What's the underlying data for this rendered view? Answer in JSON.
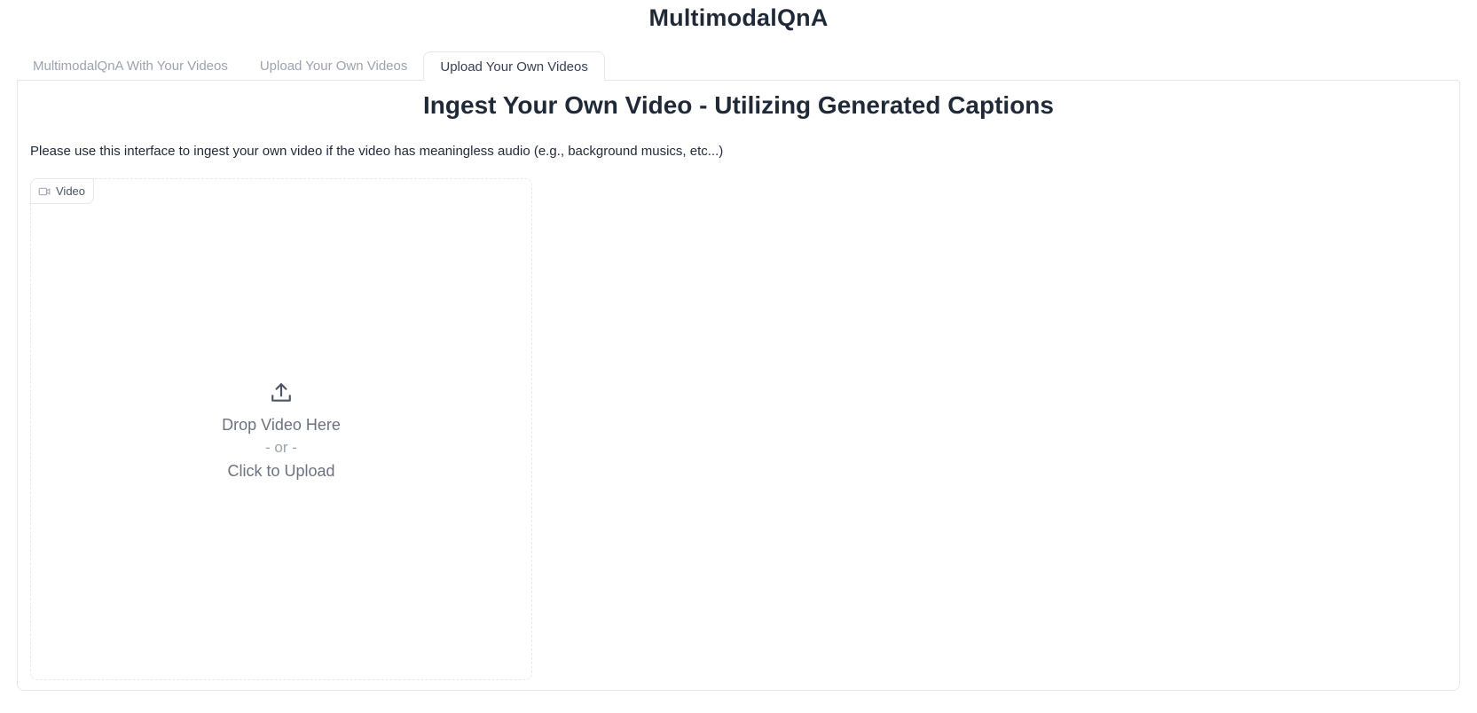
{
  "app": {
    "title": "MultimodalQnA"
  },
  "tabs": [
    {
      "label": "MultimodalQnA With Your Videos",
      "active": false
    },
    {
      "label": "Upload Your Own Videos",
      "active": false
    },
    {
      "label": "Upload Your Own Videos",
      "active": true
    }
  ],
  "panel": {
    "heading": "Ingest Your Own Video - Utilizing Generated Captions",
    "description": "Please use this interface to ingest your own video if the video has meaningless audio (e.g., background musics, etc...)"
  },
  "upload": {
    "label": "Video",
    "label_icon": "video-icon",
    "upload_icon": "upload-icon",
    "drop_text": "Drop Video Here",
    "or_text": "- or -",
    "click_text": "Click to Upload"
  },
  "colors": {
    "border": "#e5e7eb",
    "text_primary": "#1f2937",
    "text_muted": "#9ca3af",
    "text_secondary": "#6b7280"
  }
}
